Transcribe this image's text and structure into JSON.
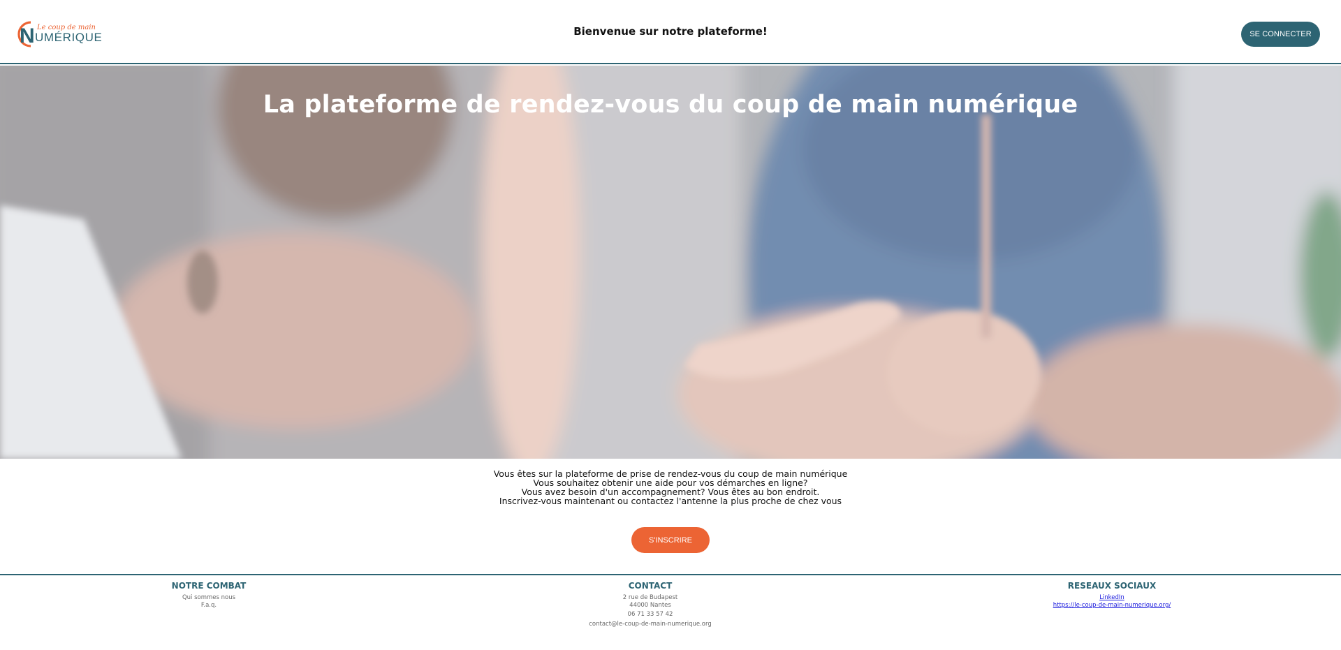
{
  "header": {
    "logo": {
      "small_text": "Le coup de main",
      "big_text": "UMÉRIQUE",
      "letter": "N"
    },
    "welcome": "Bienvenue sur notre plateforme!",
    "login_label": "SE CONNECTER"
  },
  "hero": {
    "title": "La plateforme de rendez-vous du coup de main numérique"
  },
  "intro": {
    "lines": [
      "Vous êtes sur la plateforme de prise de rendez-vous du coup de main numérique",
      "Vous souhaitez obtenir une aide pour vos démarches en ligne?",
      "Vous avez besoin d'un accompagnement? Vous êtes au bon endroit.",
      "Inscrivez-vous maintenant ou contactez l'antenne la plus proche de chez vous"
    ],
    "signup_label": "S'INSCRIRE"
  },
  "footer": {
    "combat": {
      "title": "NOTRE COMBAT",
      "links": [
        "Qui sommes nous",
        "F.a.q."
      ]
    },
    "contact": {
      "title": "CONTACT",
      "address_line1": "2 rue de Budapest",
      "address_line2": "44000 Nantes",
      "phone": "06 71 33 57 42",
      "email": "contact@le-coup-de-main-numerique.org"
    },
    "social": {
      "title": "RESEAUX SOCIAUX",
      "links": [
        "LinkedIn",
        "https://le-coup-de-main-numerique.org/"
      ]
    }
  },
  "colors": {
    "brand_teal": "#2d6473",
    "brand_orange": "#ec6434"
  }
}
